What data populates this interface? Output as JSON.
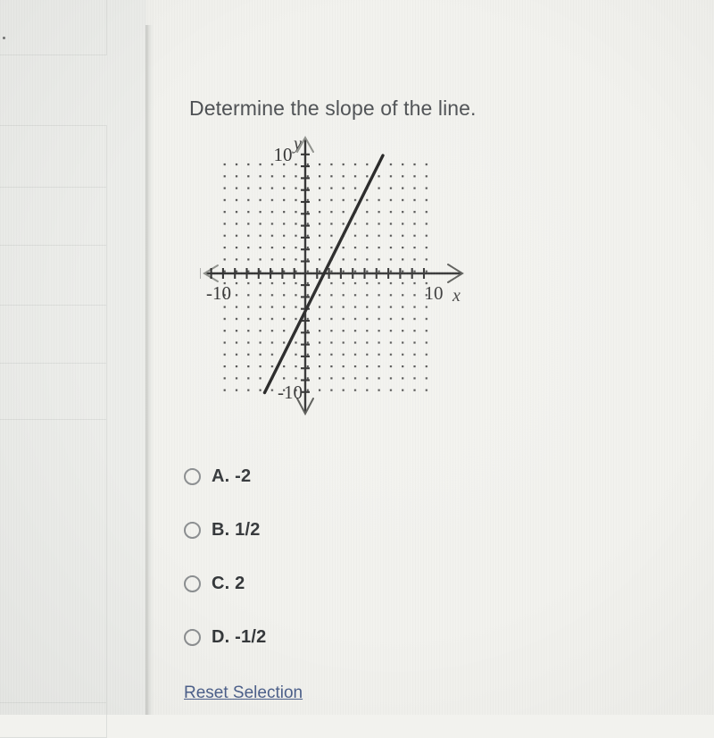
{
  "question": {
    "title": "Determine the slope of the line."
  },
  "options": [
    {
      "id": "A",
      "label": "A. -2",
      "value": "-2",
      "selected": false
    },
    {
      "id": "B",
      "label": "B. 1/2",
      "value": "1/2",
      "selected": false
    },
    {
      "id": "C",
      "label": "C. 2",
      "value": "2",
      "selected": false
    },
    {
      "id": "D",
      "label": "D. -1/2",
      "value": "-1/2",
      "selected": false
    }
  ],
  "reset": {
    "label": "Reset Selection"
  },
  "chart_data": {
    "type": "line",
    "title": "",
    "xlabel": "x",
    "ylabel": "y",
    "xlim": [
      -10,
      10
    ],
    "ylim": [
      -10,
      10
    ],
    "x_tick_labels": [
      {
        "value": -10,
        "text": "-10"
      },
      {
        "value": 10,
        "text": "10"
      }
    ],
    "y_tick_labels": [
      {
        "value": 10,
        "text": "10"
      },
      {
        "value": -10,
        "text": "-10"
      }
    ],
    "grid": "dot-grid",
    "grid_step": 1,
    "axis_arrows": true,
    "series": [
      {
        "name": "line",
        "slope": 2,
        "y_intercept": -3,
        "x_intercept": 1.5,
        "points": [
          [
            -3.5,
            -10
          ],
          [
            6.5,
            10
          ]
        ]
      }
    ],
    "legend": "none"
  },
  "colors": {
    "page_background": "#f2f2ee",
    "sidebar_background": "#ecedea",
    "text": "#4b4e51",
    "option_text": "#333639",
    "link": "#4b5f8a",
    "axis": "#2b2b2b",
    "line": "#1e1e1e",
    "dot_grid": "#3a3a3a",
    "radio_border": "#8b8e90"
  }
}
